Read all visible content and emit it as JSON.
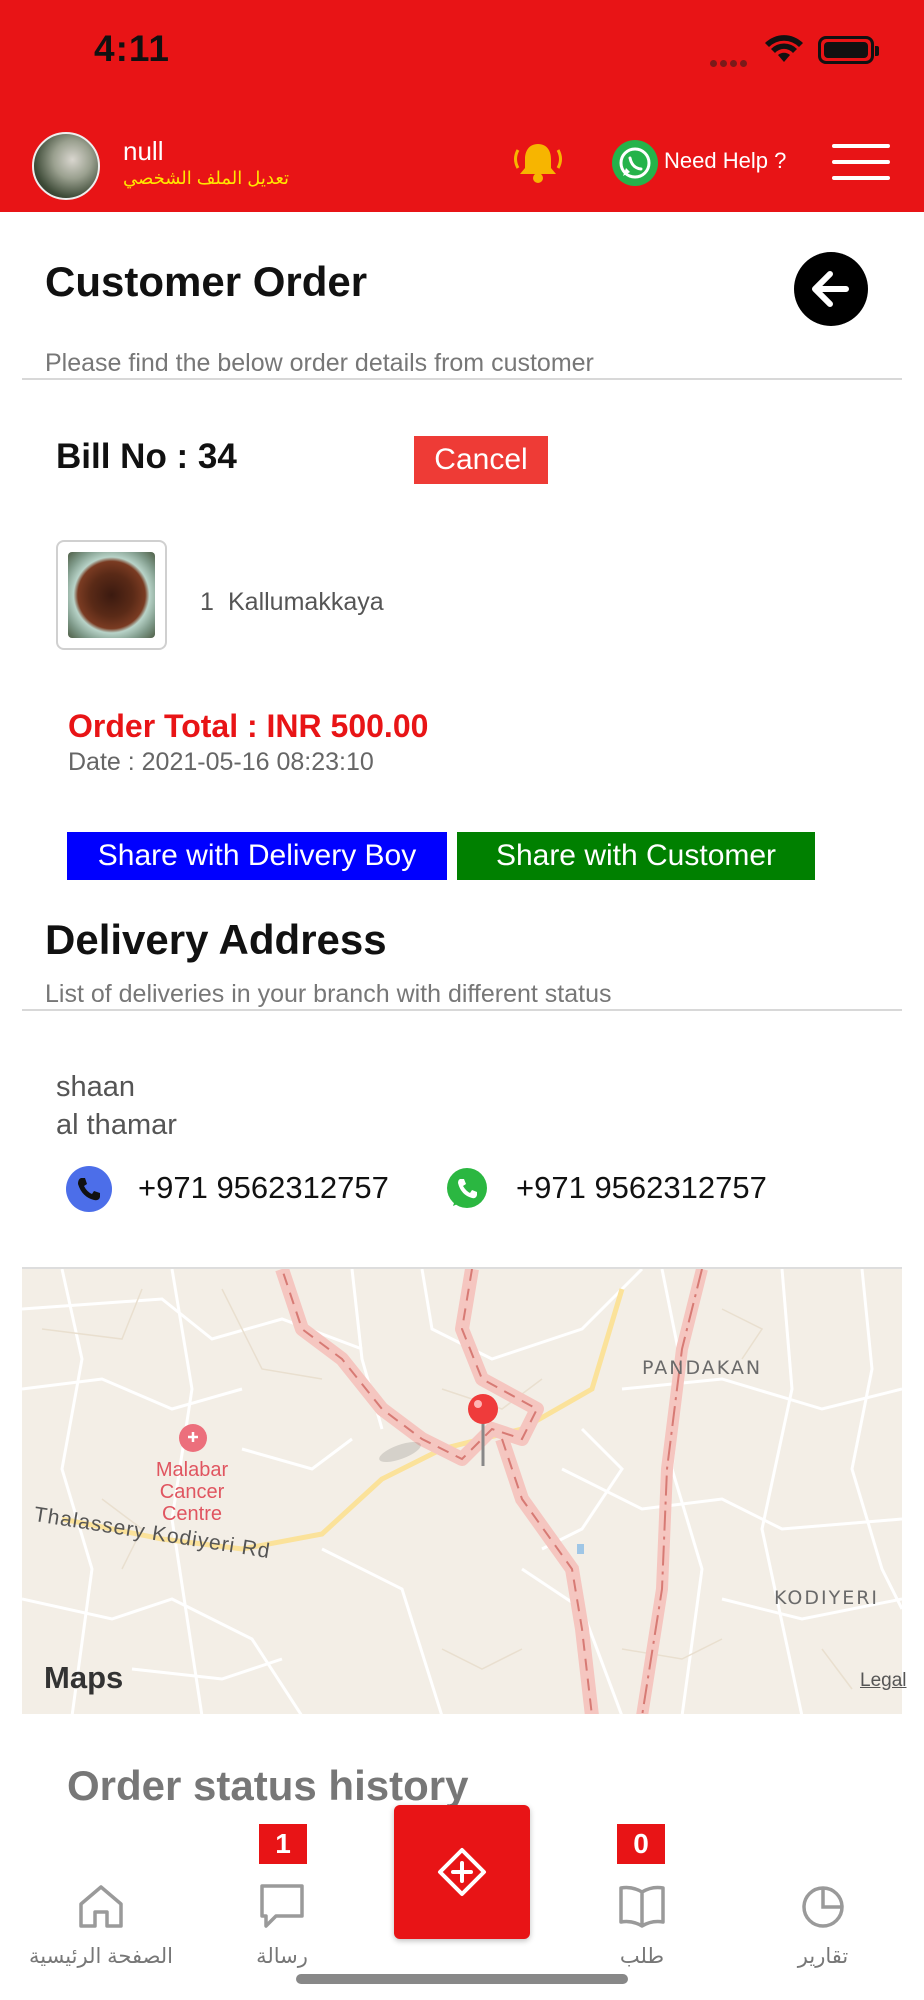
{
  "status_bar": {
    "time": "4:11"
  },
  "header": {
    "profile_name": "null",
    "profile_edit": "تعديل الملف الشخصي",
    "help_label": "Need Help ?"
  },
  "customer_order": {
    "title": "Customer Order",
    "subtitle": "Please find the below order details from customer",
    "bill_label": "Bill No : 34",
    "cancel_label": "Cancel",
    "item": {
      "qty": "1",
      "name": "Kallumakkaya"
    },
    "total": "Order Total : INR  500.00",
    "date": "Date : 2021-05-16 08:23:10",
    "share_delivery_label": "Share with Delivery Boy",
    "share_customer_label": "Share with Customer"
  },
  "delivery_address": {
    "title": "Delivery Address",
    "subtitle": "List of deliveries in your branch with different status",
    "name": "shaan",
    "address_line": "al thamar",
    "phone": "+971 9562312757",
    "whatsapp": "+971 9562312757"
  },
  "map": {
    "labels": {
      "pandakan": "PANDAKAN",
      "kodiyeri": "KODIYERI",
      "poi": "Malabar\nCancer\nCentre",
      "road": "Thalassery Kodiyeri Rd"
    },
    "provider": "Maps",
    "legal": "Legal"
  },
  "history": {
    "title": "Order status history"
  },
  "tabbar": {
    "home": "الصفحة الرئيسية",
    "messages": "رسالة",
    "messages_badge": "1",
    "orders": "طلب",
    "orders_badge": "0",
    "reports": "تقارير"
  },
  "colors": {
    "brand_red": "#e81416",
    "share_delivery": "#0000ff",
    "share_customer": "#008000",
    "cancel": "#ee3b36"
  }
}
